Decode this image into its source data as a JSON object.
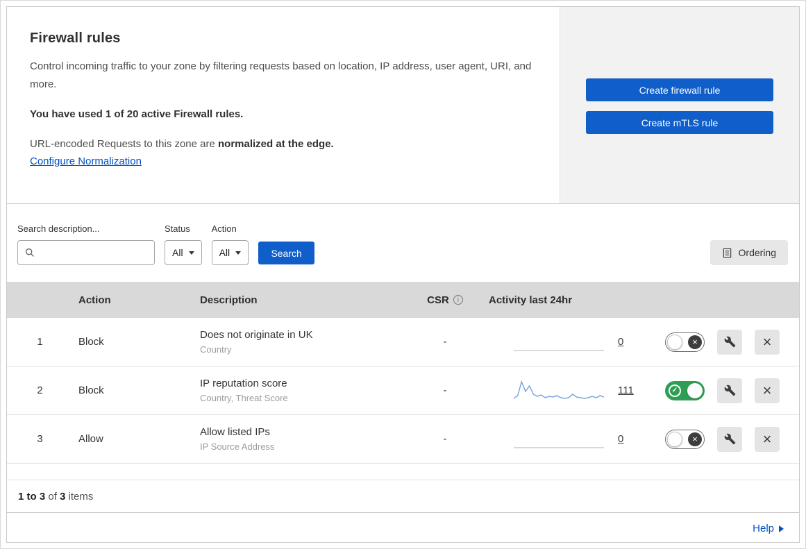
{
  "colors": {
    "primary_button_blue": "#105ec9",
    "link_blue": "#0051c3",
    "toggle_on_green": "#2f9e55",
    "table_header_gray": "#d9d9d9",
    "panel_gray": "#f2f2f2",
    "sparkline_blue": "#7aa8dc"
  },
  "header": {
    "title": "Firewall rules",
    "description": "Control incoming traffic to your zone by filtering requests based on location, IP address, user agent, URI, and more.",
    "usage_note": "You have used 1 of 20 active Firewall rules.",
    "normalization_prefix": "URL-encoded Requests to this zone are ",
    "normalization_bold": "normalized at the edge.",
    "normalization_link": "Configure Normalization",
    "buttons": {
      "create_firewall": "Create firewall rule",
      "create_mtls": "Create mTLS rule"
    }
  },
  "filters": {
    "search_label": "Search description...",
    "search_value": "",
    "status_label": "Status",
    "status_value": "All",
    "action_label": "Action",
    "action_value": "All",
    "search_button": "Search",
    "ordering_button": "Ordering"
  },
  "table": {
    "headers": {
      "action": "Action",
      "description": "Description",
      "csr": "CSR",
      "activity": "Activity last 24hr"
    },
    "rows": [
      {
        "index": "1",
        "action": "Block",
        "description": "Does not originate in UK",
        "description_sub": "Country",
        "csr": "-",
        "activity_count": "0",
        "enabled": false,
        "sparkline": [
          0,
          0,
          0,
          0,
          0,
          0,
          0,
          0,
          0,
          0,
          0,
          0,
          0,
          0,
          0,
          0,
          0,
          0,
          0,
          0,
          0,
          0,
          0,
          0
        ]
      },
      {
        "index": "2",
        "action": "Block",
        "description": "IP reputation score",
        "description_sub": "Country, Threat Score",
        "csr": "-",
        "activity_count": "111",
        "enabled": true,
        "sparkline": [
          2,
          6,
          26,
          12,
          20,
          8,
          5,
          7,
          3,
          5,
          4,
          6,
          3,
          2,
          3,
          8,
          4,
          3,
          2,
          3,
          5,
          3,
          6,
          4
        ]
      },
      {
        "index": "3",
        "action": "Allow",
        "description": "Allow listed IPs",
        "description_sub": "IP Source Address",
        "csr": "-",
        "activity_count": "0",
        "enabled": false,
        "sparkline": [
          0,
          0,
          0,
          0,
          0,
          0,
          0,
          0,
          0,
          0,
          0,
          0,
          0,
          0,
          0,
          0,
          0,
          0,
          0,
          0,
          0,
          0,
          0,
          0
        ]
      }
    ]
  },
  "footer": {
    "range": "1 to 3",
    "of_text": " of ",
    "total": "3",
    "items_text": " items",
    "help_label": "Help"
  },
  "chart_data": {
    "type": "line",
    "title": "Activity last 24hr sparkline for rule 2 (IP reputation score)",
    "values": [
      2,
      6,
      26,
      12,
      20,
      8,
      5,
      7,
      3,
      5,
      4,
      6,
      3,
      2,
      3,
      8,
      4,
      3,
      2,
      3,
      5,
      3,
      6,
      4
    ],
    "total_events": 111
  }
}
